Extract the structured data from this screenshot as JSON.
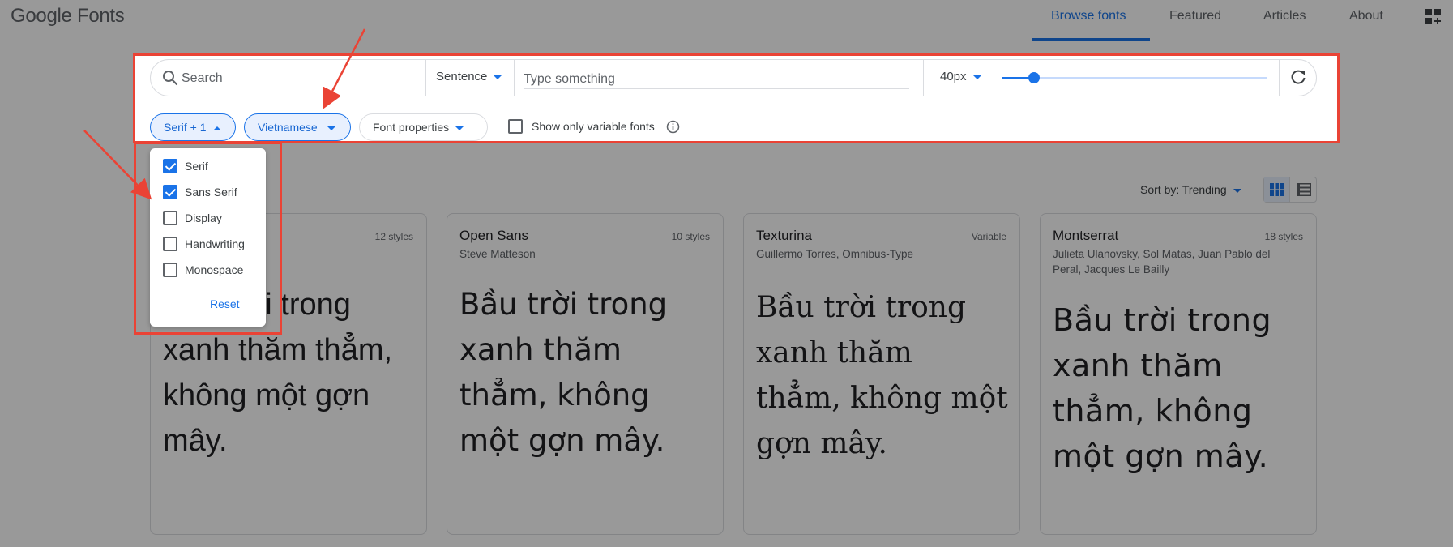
{
  "header": {
    "logo": "Google Fonts",
    "nav": [
      "Browse fonts",
      "Featured",
      "Articles",
      "About"
    ],
    "active_nav": "Browse fonts"
  },
  "toolbar": {
    "search_placeholder": "Search",
    "preview_mode": "Sentence",
    "type_placeholder": "Type something",
    "font_size": "40px",
    "font_size_slider_fraction": 0.12
  },
  "filters": {
    "category_chip": "Serif + 1",
    "language_chip": "Vietnamese",
    "properties_chip": "Font properties",
    "variable_label": "Show only variable fonts",
    "variable_checked": false
  },
  "category_menu": {
    "items": [
      {
        "label": "Serif",
        "checked": true
      },
      {
        "label": "Sans Serif",
        "checked": true
      },
      {
        "label": "Display",
        "checked": false
      },
      {
        "label": "Handwriting",
        "checked": false
      },
      {
        "label": "Monospace",
        "checked": false
      }
    ],
    "reset": "Reset"
  },
  "results": {
    "sort_label": "Sort by: Trending",
    "view_modes": [
      "grid-view-icon",
      "list-view-icon"
    ],
    "active_view": "grid"
  },
  "cards": [
    {
      "name": "",
      "styles": "12 styles",
      "author": "",
      "sample_lines": [
        "Bầu trời trong",
        "xanh thăm thẳm,",
        "không một gợn",
        "mây."
      ]
    },
    {
      "name": "Open Sans",
      "styles": "10 styles",
      "author": "Steve Matteson",
      "sample_lines": [
        "Bầu trời trong",
        "xanh thăm",
        "thẳm, không",
        "một gợn mây."
      ]
    },
    {
      "name": "Texturina",
      "styles": "Variable",
      "author": "Guillermo Torres, Omnibus-Type",
      "sample_lines": [
        "Bầu trời trong",
        "xanh thăm",
        "thẳm, không một",
        "gợn mây."
      ]
    },
    {
      "name": "Montserrat",
      "styles": "18 styles",
      "author": "Julieta Ulanovsky, Sol Matas, Juan Pablo del Peral, Jacques Le Bailly",
      "sample_lines": [
        "Bầu trời trong",
        "xanh thăm",
        "thẳm, không",
        "một gợn mây."
      ]
    }
  ],
  "colors": {
    "accent": "#1a73e8",
    "annotation": "#ea4335",
    "overlay": "rgba(0,0,0,0.40)"
  }
}
